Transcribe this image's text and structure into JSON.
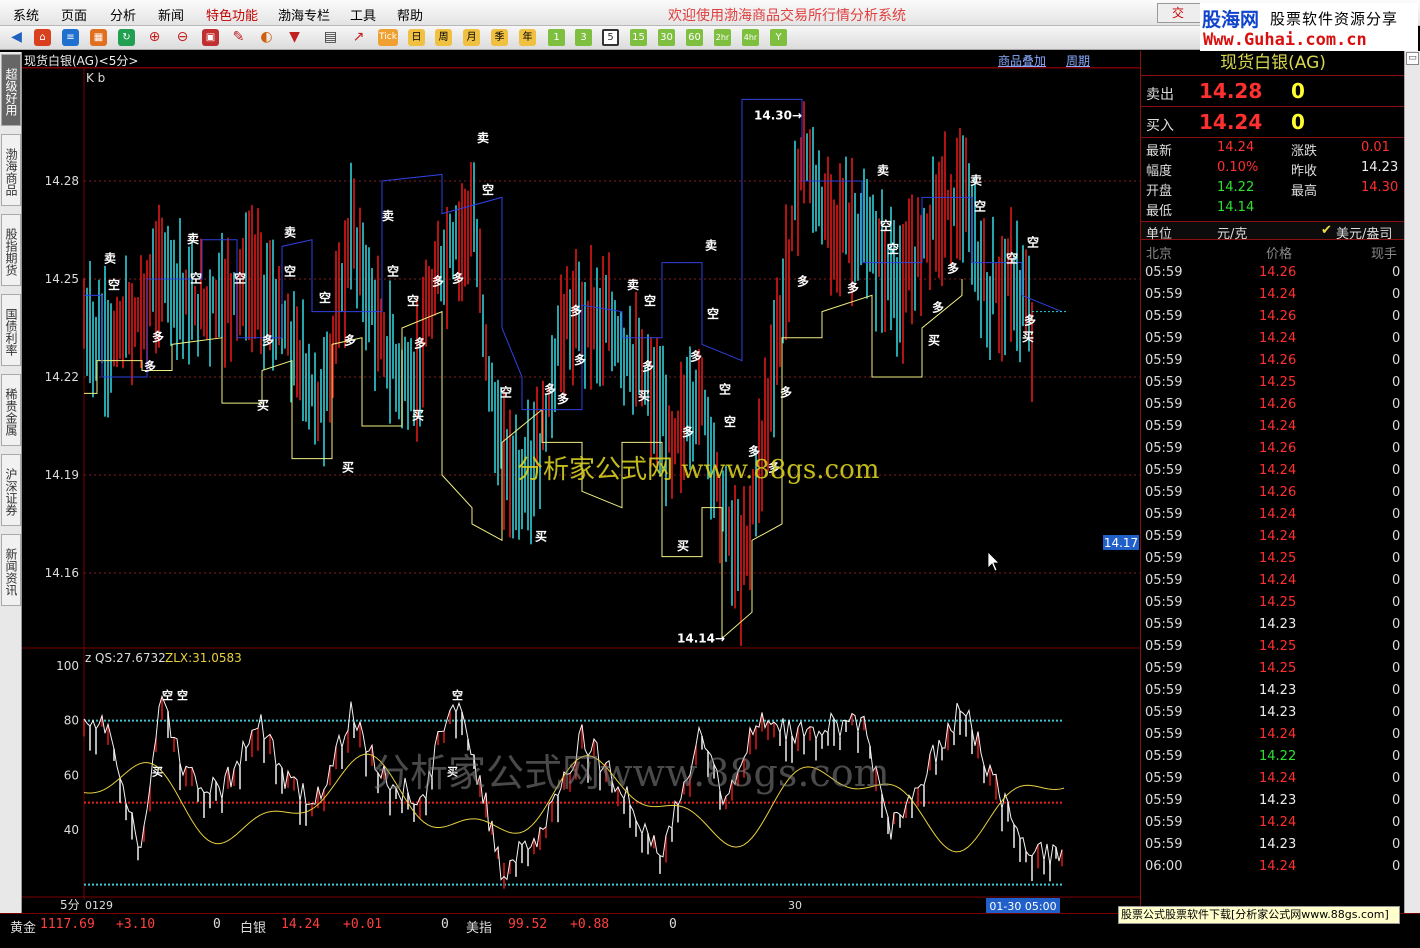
{
  "menu": [
    "系统",
    "页面",
    "分析",
    "新闻",
    "特色功能",
    "渤海专栏",
    "工具",
    "帮助"
  ],
  "app_title": "欢迎使用渤海商品交易所行情分析系统",
  "quick_button": "交",
  "logo": {
    "line1": "股海网",
    "line1b": "股票软件资源分享",
    "line2": "Www.Guhai.com.cn"
  },
  "toolbar": {
    "tick_label": "Tick",
    "periods": [
      "日",
      "周",
      "月",
      "季",
      "年",
      "1",
      "3",
      "5",
      "15",
      "30",
      "60",
      "2hr",
      "4hr",
      "Y"
    ],
    "active_period": "5"
  },
  "sidebar": {
    "tabs": [
      "超级好用",
      "渤海商品",
      "股指期货",
      "国债利率",
      "稀贵金属",
      "沪深证券",
      "新闻资讯"
    ]
  },
  "chart": {
    "title": "现货白银(AG)<5分>",
    "overlay_link": "商品叠加",
    "period_link": "周期",
    "main_label": "K b",
    "y_ticks": [
      "14.28",
      "14.25",
      "14.22",
      "14.19",
      "14.16"
    ],
    "high_label": "14.30",
    "low_label": "14.14",
    "cursor_price": "14.17",
    "watermark_main": "分析家公式网 www.88gs.com",
    "watermark_sub": "分析家公式网www.88gs.com",
    "signals": {
      "sell": "卖",
      "buy": "买",
      "short": "空",
      "long": "多"
    },
    "sub_label": "z",
    "qs_text": "QS:27.6732",
    "zlx_text": "ZLX:31.0583",
    "sub_y_ticks": [
      "100",
      "80",
      "60",
      "40"
    ],
    "period_text": "5分",
    "x_start": "0129",
    "x_mid": "30",
    "x_end": "01-30 05:00",
    "colors": {
      "up": "#e01818",
      "down": "#30d0d8",
      "stop": "#f0f080",
      "resist": "#3040e0",
      "grid": "#7a0000"
    }
  },
  "quote": {
    "title": "现货白银(AG)",
    "sell_label": "卖出",
    "sell_price": "14.28",
    "sell_vol": "0",
    "buy_label": "买入",
    "buy_price": "14.24",
    "buy_vol": "0",
    "stats": [
      {
        "label": "最新",
        "value": "14.24",
        "label2": "涨跌",
        "value2": "0.01"
      },
      {
        "label": "幅度",
        "value": "0.10%",
        "label2": "昨收",
        "value2": "14.23"
      },
      {
        "label": "开盘",
        "value": "14.22",
        "label2": "最高",
        "value2": "14.30"
      },
      {
        "label": "最低",
        "value": "14.14",
        "label2": "",
        "value2": ""
      }
    ],
    "unit_label": "单位",
    "unit_value": "元/克",
    "alt_unit": "美元/盎司",
    "tick_headers": [
      "北京",
      "价格",
      "现手"
    ],
    "ticks": [
      {
        "time": "05:59",
        "price": "14.26",
        "vol": "0"
      },
      {
        "time": "05:59",
        "price": "14.24",
        "vol": "0"
      },
      {
        "time": "05:59",
        "price": "14.26",
        "vol": "0"
      },
      {
        "time": "05:59",
        "price": "14.24",
        "vol": "0"
      },
      {
        "time": "05:59",
        "price": "14.26",
        "vol": "0"
      },
      {
        "time": "05:59",
        "price": "14.25",
        "vol": "0"
      },
      {
        "time": "05:59",
        "price": "14.26",
        "vol": "0"
      },
      {
        "time": "05:59",
        "price": "14.24",
        "vol": "0"
      },
      {
        "time": "05:59",
        "price": "14.26",
        "vol": "0"
      },
      {
        "time": "05:59",
        "price": "14.24",
        "vol": "0"
      },
      {
        "time": "05:59",
        "price": "14.26",
        "vol": "0"
      },
      {
        "time": "05:59",
        "price": "14.24",
        "vol": "0"
      },
      {
        "time": "05:59",
        "price": "14.24",
        "vol": "0"
      },
      {
        "time": "05:59",
        "price": "14.25",
        "vol": "0"
      },
      {
        "time": "05:59",
        "price": "14.24",
        "vol": "0"
      },
      {
        "time": "05:59",
        "price": "14.25",
        "vol": "0"
      },
      {
        "time": "05:59",
        "price": "14.23",
        "vol": "0"
      },
      {
        "time": "05:59",
        "price": "14.25",
        "vol": "0"
      },
      {
        "time": "05:59",
        "price": "14.25",
        "vol": "0"
      },
      {
        "time": "05:59",
        "price": "14.23",
        "vol": "0"
      },
      {
        "time": "05:59",
        "price": "14.23",
        "vol": "0"
      },
      {
        "time": "05:59",
        "price": "14.24",
        "vol": "0"
      },
      {
        "time": "05:59",
        "price": "14.22",
        "vol": "0"
      },
      {
        "time": "05:59",
        "price": "14.24",
        "vol": "0"
      },
      {
        "time": "05:59",
        "price": "14.23",
        "vol": "0"
      },
      {
        "time": "05:59",
        "price": "14.24",
        "vol": "0"
      },
      {
        "time": "05:59",
        "price": "14.23",
        "vol": "0"
      },
      {
        "time": "06:00",
        "price": "14.24",
        "vol": "0"
      }
    ]
  },
  "status": {
    "gold_label": "黄金",
    "gold_price": "1117.69",
    "gold_change": "+3.10",
    "gold_vol": "0",
    "silver_label": "白银",
    "silver_price": "14.24",
    "silver_change": "+0.01",
    "silver_vol": "0",
    "usd_label": "美指",
    "usd_price": "99.52",
    "usd_change": "+0.88",
    "usd_vol": "0"
  },
  "footer_banner": "股票公式股票软件下载[分析家公式网www.88gs.com]"
}
